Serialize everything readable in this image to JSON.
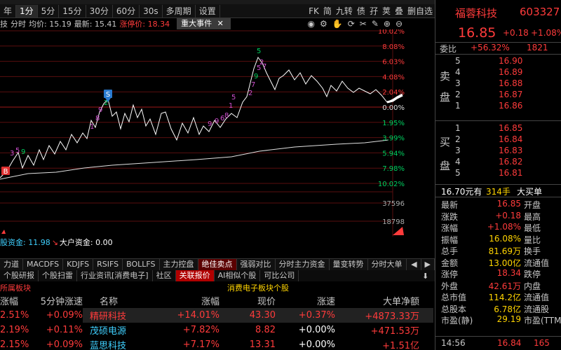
{
  "toolbar": {
    "items": [
      "年",
      "1分",
      "5分",
      "15分",
      "30分",
      "60分",
      "30s",
      "多周期",
      "设置"
    ],
    "active_index": 1,
    "right_items": [
      "FK",
      "简",
      "九转",
      "债",
      "孖",
      "荚",
      "叠",
      "删自选"
    ]
  },
  "infobar": {
    "prefix": "技",
    "mode": "分时",
    "avg_label": "均价: 15.19",
    "latest_label": "最新: 15.41",
    "limit_label": "涨停价: 18.34",
    "event_tab": "重大事件",
    "event_close": "✕"
  },
  "chart_data": {
    "type": "line",
    "y_right_labels": [
      "10.02%",
      "8.08%",
      "6.03%",
      "4.08%",
      "2.04%",
      "0.00%",
      "1.95%",
      "3.99%",
      "5.94%",
      "7.98%",
      "10.02%"
    ],
    "volume_labels": [
      "37596",
      "18798"
    ],
    "markers": [
      {
        "label": "S",
        "kind": "sell"
      },
      {
        "label": "B",
        "kind": "buy"
      }
    ],
    "digit_labels": [
      "3",
      "5",
      "9",
      "1",
      "8",
      "9",
      "2",
      "9",
      "9",
      "6",
      "8",
      "1",
      "5",
      "2",
      "7",
      "9",
      "5",
      "2",
      "5",
      "7"
    ],
    "price_path_desc": "intraday price line",
    "colors": {
      "price": "#ffffff",
      "avg": "#e8e8e8",
      "grid": "#7a1010",
      "up": "#ff3b3b",
      "down": "#00d060"
    }
  },
  "fundbar": {
    "label": "股资金: 11.98",
    "arrow": "↘",
    "big_label": "大户资金: 0.00"
  },
  "right_panel": {
    "name": "福蓉科技",
    "code": "603327",
    "price": "16.85",
    "change": "+0.18",
    "change_pct": "+1.08%",
    "weibi_label": "委比",
    "weibi": "+56.32%",
    "weicha": "1821",
    "sell_label_1": "卖",
    "sell_label_2": "盘",
    "buy_label_1": "买",
    "buy_label_2": "盘",
    "sells": [
      {
        "lvl": "5",
        "price": "16.90",
        "vol": ""
      },
      {
        "lvl": "4",
        "price": "16.89",
        "vol": ""
      },
      {
        "lvl": "3",
        "price": "16.88",
        "vol": ""
      },
      {
        "lvl": "2",
        "price": "16.87",
        "vol": ""
      },
      {
        "lvl": "1",
        "price": "16.86",
        "vol": ""
      }
    ],
    "buys": [
      {
        "lvl": "1",
        "price": "16.85",
        "vol": ""
      },
      {
        "lvl": "2",
        "price": "16.84",
        "vol": ""
      },
      {
        "lvl": "3",
        "price": "16.83",
        "vol": ""
      },
      {
        "lvl": "4",
        "price": "16.82",
        "vol": ""
      },
      {
        "lvl": "5",
        "price": "16.81",
        "vol": ""
      }
    ],
    "big_order": {
      "price": "16.70元有",
      "qty": "314手",
      "label": "大买单"
    },
    "stats": [
      {
        "k": "最新",
        "v": "16.85",
        "k2": "开盘"
      },
      {
        "k": "涨跌",
        "v": "+0.18",
        "k2": "最高"
      },
      {
        "k": "涨幅",
        "v": "+1.08%",
        "k2": "最低"
      },
      {
        "k": "振幅",
        "v": "16.08%",
        "k2": "量比"
      },
      {
        "k": "总手",
        "v": "81.69万",
        "k2": "换手"
      },
      {
        "k": "金额",
        "v": "13.00亿",
        "k2": "流通值"
      },
      {
        "k": "涨停",
        "v": "18.34",
        "k2": "跌停"
      },
      {
        "k": "外盘",
        "v": "42.61万",
        "k2": "内盘"
      },
      {
        "k": "总市值",
        "v": "114.2亿",
        "k2": "流通值"
      },
      {
        "k": "总股本",
        "v": "6.78亿",
        "k2": "流通股"
      },
      {
        "k": "市盈(静)",
        "v": "29.19",
        "k2": "市盈(TTM)"
      }
    ],
    "tick": {
      "time": "14:56",
      "price": "16.84",
      "vol": "165"
    }
  },
  "tabs1": [
    "力道",
    "MACDFS",
    "KDJFS",
    "RSIFS",
    "BOLLFS",
    "主力控盘",
    "绝佳卖点",
    "强弱对比",
    "分时主力资金",
    "量变转势",
    "分时大单"
  ],
  "tabs1_active": 6,
  "tabs2": [
    "个股研报",
    "个股扫雷",
    "行业资讯[消费电子]",
    "社区",
    "关联报价",
    "AI相似个股",
    "可比公司"
  ],
  "tabs2_active": 4,
  "sector": {
    "title": "所属板块",
    "col1": "涨幅",
    "col2": "5分钟涨速",
    "rows": [
      {
        "a": "2.51%",
        "b": "+0.09%"
      },
      {
        "a": "2.19%",
        "b": "+0.11%"
      },
      {
        "a": "2.15%",
        "b": "+0.09%"
      }
    ]
  },
  "table": {
    "title": "消费电子板块个股",
    "headers": [
      "名称",
      "涨幅",
      "现价",
      "涨速",
      "大单净额"
    ],
    "rows": [
      {
        "name": "精研科技",
        "pct": "+14.01%",
        "price": "43.30",
        "speed": "+0.37%",
        "net": "+4873.33万"
      },
      {
        "name": "茂硕电源",
        "pct": "+7.82%",
        "price": "8.82",
        "speed": "+0.00%",
        "net": "+471.53万"
      },
      {
        "name": "蓝思科技",
        "pct": "+7.17%",
        "price": "13.31",
        "speed": "+0.00%",
        "net": "+1.51亿"
      }
    ]
  }
}
